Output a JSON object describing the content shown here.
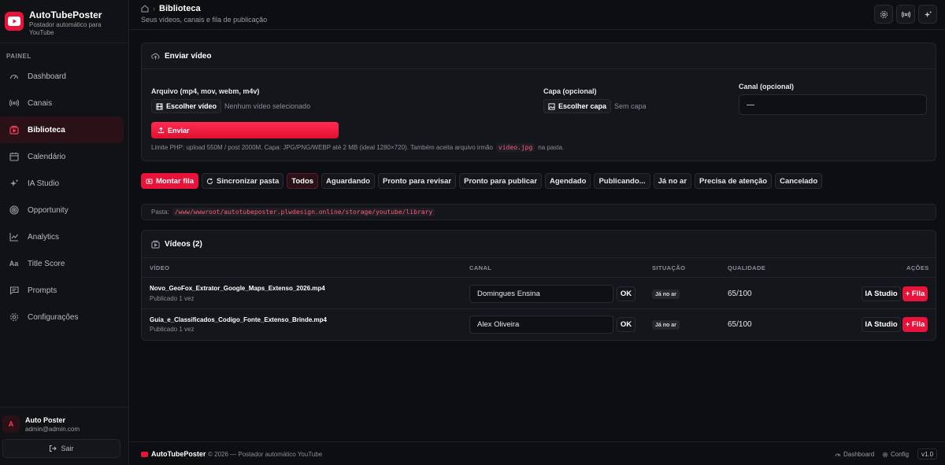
{
  "colors": {
    "accent": "#e8133a",
    "background": "#0d0e12",
    "panel": "#15161b"
  },
  "brand": {
    "title": "AutoTubePoster",
    "subtitle": "Postador automático para YouTube"
  },
  "sidebar": {
    "section_label": "PAINEL",
    "items": [
      {
        "label": "Dashboard",
        "icon": "dashboard-gauge-icon",
        "active": false
      },
      {
        "label": "Canais",
        "icon": "broadcast-icon",
        "active": false
      },
      {
        "label": "Biblioteca",
        "icon": "library-icon",
        "active": true
      },
      {
        "label": "Calendário",
        "icon": "calendar-icon",
        "active": false
      },
      {
        "label": "IA Studio",
        "icon": "sparkles-icon",
        "active": false
      },
      {
        "label": "Opportunity",
        "icon": "target-icon",
        "active": false
      },
      {
        "label": "Analytics",
        "icon": "chart-line-icon",
        "active": false
      },
      {
        "label": "Title Score",
        "icon": "text-aa-icon",
        "active": false
      },
      {
        "label": "Prompts",
        "icon": "message-icon",
        "active": false
      },
      {
        "label": "Configurações",
        "icon": "gear-icon",
        "active": false
      }
    ],
    "user": {
      "initial": "A",
      "name": "Auto Poster",
      "email": "admin@admin.com"
    },
    "logout_label": "Sair"
  },
  "header": {
    "breadcrumb_title": "Biblioteca",
    "subtitle": "Seus vídeos, canais e fila de publicação"
  },
  "upload": {
    "title": "Enviar vídeo",
    "file_label": "Arquivo (mp4, mov, webm, m4v)",
    "file_button": "Escolher vídeo",
    "file_status": "Nenhum vídeo selecionado",
    "cover_label": "Capa (opcional)",
    "cover_button": "Escolher capa",
    "cover_status": "Sem capa",
    "channel_label": "Canal (opcional)",
    "channel_value": "—",
    "send_button": "Enviar",
    "hint_before": "Limite PHP: upload 550M / post 2000M. Capa: JPG/PNG/WEBP até 2 MB (ideal 1280×720). Também aceita arquivo irmão",
    "hint_code": "video.jpg",
    "hint_after": "na pasta."
  },
  "filters": {
    "build_queue": "Montar fila",
    "sync_folder": "Sincronizar pasta",
    "status_tabs": [
      "Todos",
      "Aguardando",
      "Pronto para revisar",
      "Pronto para publicar",
      "Agendado",
      "Publicando...",
      "Já no ar",
      "Precisa de atenção",
      "Cancelado"
    ]
  },
  "folder": {
    "label": "Pasta:",
    "path": "/www/wwwroot/autotubeposter.plwdesign.online/storage/youtube/library"
  },
  "videos": {
    "title": "Vídeos (2)",
    "columns": [
      "VÍDEO",
      "CANAL",
      "SITUAÇÃO",
      "QUALIDADE",
      "AÇÕES"
    ],
    "ok_label": "OK",
    "ia_label": "IA Studio",
    "queue_label": "+ Fila",
    "rows": [
      {
        "name": "Novo_GeoFox_Extrator_Google_Maps_Extenso_2026.mp4",
        "published": "Publicado 1 vez",
        "channel": "Domingues Ensina",
        "status": "Já no ar",
        "quality": "65/100"
      },
      {
        "name": "Guia_e_Classificados_Codigo_Fonte_Extenso_Brinde.mp4",
        "published": "Publicado 1 vez",
        "channel": "Alex Oliveira",
        "status": "Já no ar",
        "quality": "65/100"
      }
    ]
  },
  "footer": {
    "brand": "AutoTubePoster",
    "copyright": "© 2026 — Postador automático YouTube",
    "dashboard_link": "Dashboard",
    "config_link": "Config",
    "version": "v1.0"
  }
}
